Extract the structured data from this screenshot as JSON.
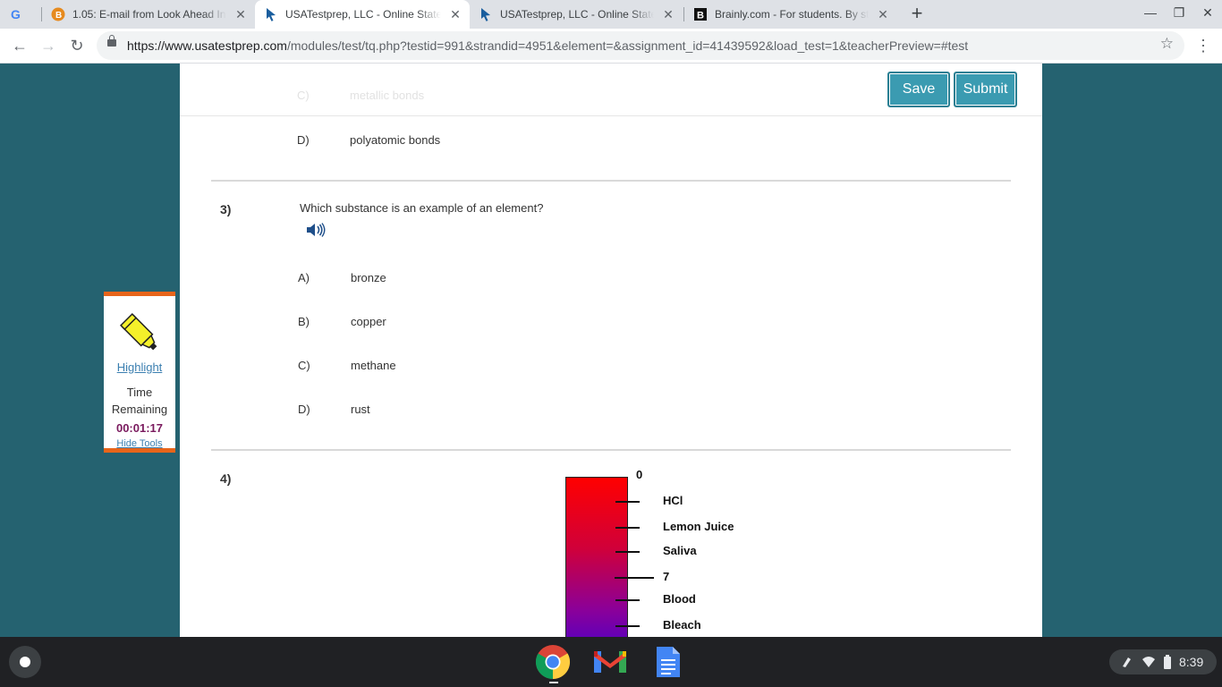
{
  "browser": {
    "tabs": [
      {
        "title": "",
        "favicon": "google-icon"
      },
      {
        "title": "1.05: E-mail from Look Ahead In",
        "favicon": "course-icon"
      },
      {
        "title": "USATestprep, LLC - Online State-S",
        "favicon": "cursor-icon",
        "active": true
      },
      {
        "title": "USATestprep, LLC - Online State-S",
        "favicon": "cursor-icon"
      },
      {
        "title": "Brainly.com - For students. By stu",
        "favicon": "brainly-icon"
      }
    ],
    "new_tab": "+",
    "url_domain": "https://www.usatestprep.com",
    "url_path": "/modules/test/tq.php?testid=991&strandid=4951&element=&assignment_id=41439592&load_test=1&teacherPreview=#test"
  },
  "page": {
    "save_label": "Save",
    "submit_label": "Submit",
    "prev_option_letter": "C)",
    "prev_option_text": "metallic bonds",
    "q2_option_d_letter": "D)",
    "q2_option_d_text": "polyatomic bonds",
    "q3": {
      "number": "3)",
      "text": "Which substance is an example of an element?",
      "options": [
        {
          "letter": "A)",
          "text": "bronze"
        },
        {
          "letter": "B)",
          "text": "copper"
        },
        {
          "letter": "C)",
          "text": "methane"
        },
        {
          "letter": "D)",
          "text": "rust"
        }
      ]
    },
    "q4": {
      "number": "4)"
    }
  },
  "tools": {
    "highlight_label": "Highlight",
    "time_remaining_label": "Time Remaining",
    "timer": "00:01:17",
    "hide_tools_label": "Hide Tools"
  },
  "chart_data": {
    "type": "table",
    "scale_top_label": "0",
    "labels": [
      "HCl",
      "Lemon Juice",
      "Saliva",
      "7",
      "Blood",
      "Bleach"
    ]
  },
  "shelf": {
    "apps": [
      "chrome-icon",
      "gmail-icon",
      "docs-icon"
    ],
    "clock": "8:39"
  },
  "colors": {
    "page_bg": "#256270",
    "button": "#3b9bb1",
    "tools_accent": "#e8651a",
    "timer": "#7a1a5e"
  }
}
